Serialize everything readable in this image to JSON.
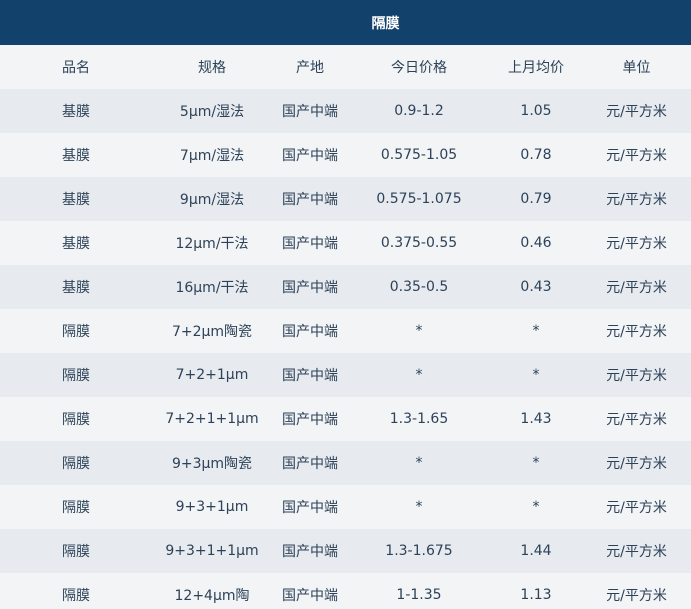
{
  "title": "隔膜",
  "columns": [
    "品名",
    "规格",
    "产地",
    "今日价格",
    "上月均价",
    "单位"
  ],
  "rows": [
    {
      "name": "基膜",
      "spec": "5μm/湿法",
      "origin": "国产中端",
      "price_today": "0.9-1.2",
      "last_month_avg": "1.05",
      "unit": "元/平方米"
    },
    {
      "name": "基膜",
      "spec": "7μm/湿法",
      "origin": "国产中端",
      "price_today": "0.575-1.05",
      "last_month_avg": "0.78",
      "unit": "元/平方米"
    },
    {
      "name": "基膜",
      "spec": "9μm/湿法",
      "origin": "国产中端",
      "price_today": "0.575-1.075",
      "last_month_avg": "0.79",
      "unit": "元/平方米"
    },
    {
      "name": "基膜",
      "spec": "12μm/干法",
      "origin": "国产中端",
      "price_today": "0.375-0.55",
      "last_month_avg": "0.46",
      "unit": "元/平方米"
    },
    {
      "name": "基膜",
      "spec": "16μm/干法",
      "origin": "国产中端",
      "price_today": "0.35-0.5",
      "last_month_avg": "0.43",
      "unit": "元/平方米"
    },
    {
      "name": "隔膜",
      "spec": "7+2μm陶瓷",
      "origin": "国产中端",
      "price_today": "*",
      "last_month_avg": "*",
      "unit": "元/平方米"
    },
    {
      "name": "隔膜",
      "spec": "7+2+1μm",
      "origin": "国产中端",
      "price_today": "*",
      "last_month_avg": "*",
      "unit": "元/平方米"
    },
    {
      "name": "隔膜",
      "spec": "7+2+1+1μm",
      "origin": "国产中端",
      "price_today": "1.3-1.65",
      "last_month_avg": "1.43",
      "unit": "元/平方米"
    },
    {
      "name": "隔膜",
      "spec": "9+3μm陶瓷",
      "origin": "国产中端",
      "price_today": "*",
      "last_month_avg": "*",
      "unit": "元/平方米"
    },
    {
      "name": "隔膜",
      "spec": "9+3+1μm",
      "origin": "国产中端",
      "price_today": "*",
      "last_month_avg": "*",
      "unit": "元/平方米"
    },
    {
      "name": "隔膜",
      "spec": "9+3+1+1μm",
      "origin": "国产中端",
      "price_today": "1.3-1.675",
      "last_month_avg": "1.44",
      "unit": "元/平方米"
    },
    {
      "name": "隔膜",
      "spec": "12+4μm陶",
      "origin": "国产中端",
      "price_today": "1-1.35",
      "last_month_avg": "1.13",
      "unit": "元/平方米"
    }
  ],
  "colors": {
    "header_bg": "#12416b",
    "row_light": "#f2f4f6",
    "row_dark": "#e7eaee",
    "text": "#2d4258"
  }
}
